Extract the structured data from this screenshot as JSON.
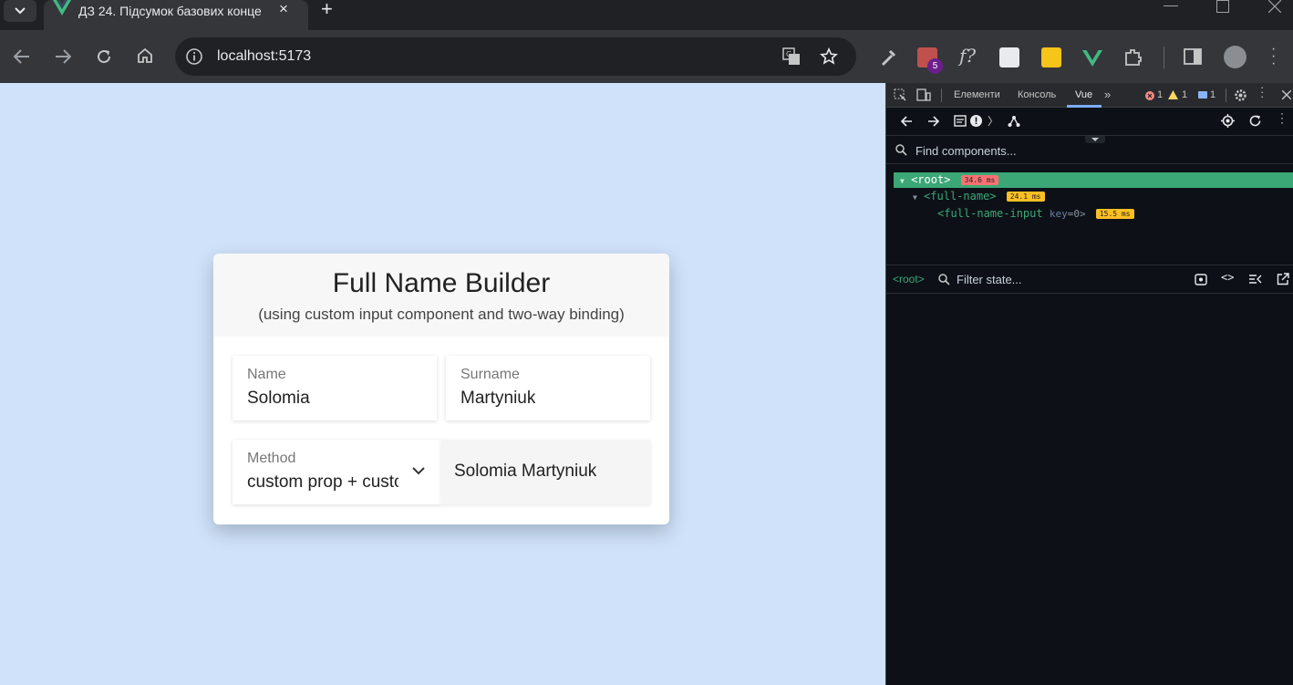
{
  "browser": {
    "tab_title": "ДЗ 24. Підсумок базових конце",
    "address": "localhost:5173",
    "extension_badge": "5",
    "new_tab_glyph": "+",
    "close_tab_glyph": "×"
  },
  "app": {
    "title": "Full Name Builder",
    "subtitle": "(using custom input component and two-way binding)",
    "name_label": "Name",
    "name_value": "Solomia",
    "surname_label": "Surname",
    "surname_value": "Martyniuk",
    "method_label": "Method",
    "method_value": "custom prop + custom event",
    "result": "Solomia Martyniuk"
  },
  "devtools": {
    "tabs": [
      "Елементи",
      "Консоль",
      "Vue"
    ],
    "errors": "1",
    "warnings": "1",
    "info": "1",
    "find_placeholder": "Find components...",
    "tree": [
      {
        "name": "<root>",
        "time": "34.6 ms"
      },
      {
        "name": "<full-name>",
        "time": "24.1 ms"
      },
      {
        "name": "<full-name-input",
        "attr": "key",
        "attr_value": "=0>",
        "time": "15.5 ms"
      }
    ],
    "selected_component": "<root>",
    "filter_placeholder": "Filter state..."
  },
  "colors": {
    "page_bg": "#cfe2fa",
    "vue_green": "#42b883",
    "badge_red": "#f87171",
    "badge_yellow": "#fbbf24",
    "devtools_bg": "#0d1117"
  }
}
